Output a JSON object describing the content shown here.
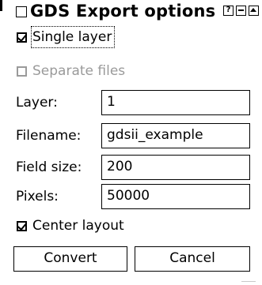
{
  "window": {
    "title": "GDS Export options",
    "help_button": "?",
    "accent": "#000000"
  },
  "options": {
    "single_layer": {
      "label": "Single layer",
      "checked": true
    },
    "separate_files": {
      "label": "Separate files",
      "checked": false,
      "disabled": true
    },
    "center_layout": {
      "label": "Center layout",
      "checked": true
    }
  },
  "fields": {
    "layer": {
      "label": "Layer:",
      "value": "1"
    },
    "filename": {
      "label": "Filename:",
      "value": "gdsii_example"
    },
    "field_size": {
      "label": "Field size:",
      "value": "200"
    },
    "pixels": {
      "label": "Pixels:",
      "value": "50000"
    }
  },
  "buttons": {
    "convert": "Convert",
    "cancel": "Cancel"
  },
  "colors": {
    "text": "#000000",
    "disabled_text": "#9a9a9a",
    "background": "#ffffff"
  }
}
